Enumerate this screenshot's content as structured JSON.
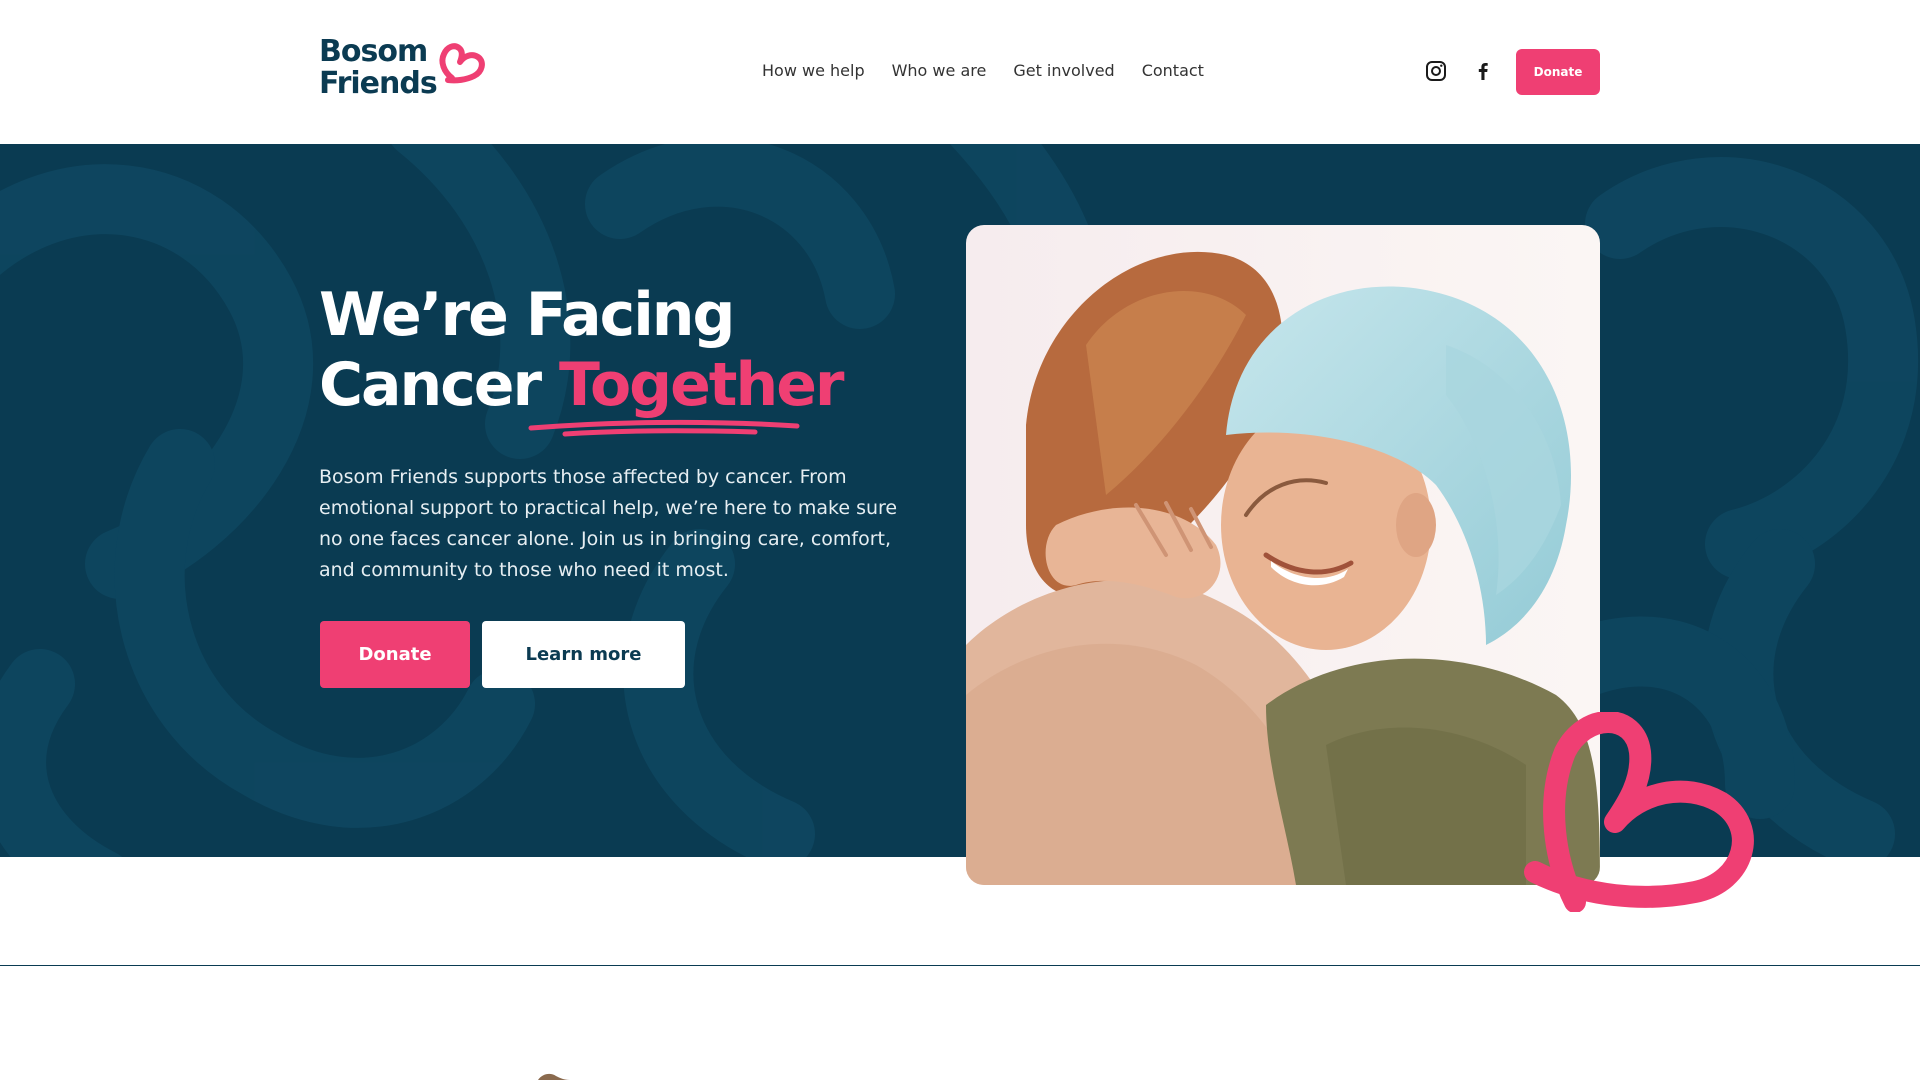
{
  "brand": {
    "line1": "Bosom",
    "line2": "Friends",
    "colors": {
      "navy": "#0a3b52",
      "pink": "#ef3f73",
      "white": "#ffffff"
    }
  },
  "nav": {
    "items": [
      "How we help",
      "Who we are",
      "Get involved",
      "Contact"
    ]
  },
  "social": {
    "instagram_icon": "instagram-icon",
    "facebook_icon": "facebook-icon"
  },
  "header": {
    "donate_label": "Donate"
  },
  "hero": {
    "title_line1": "We’re Facing",
    "title_line2_start": "Cancer ",
    "title_accent": "Together",
    "body": "Bosom Friends supports those affected by cancer. From emotional support to practical help, we’re here to make sure no one faces cancer alone. Join us in bringing care, comfort, and community to those who need it most.",
    "donate_label": "Donate",
    "learn_more_label": "Learn more"
  }
}
